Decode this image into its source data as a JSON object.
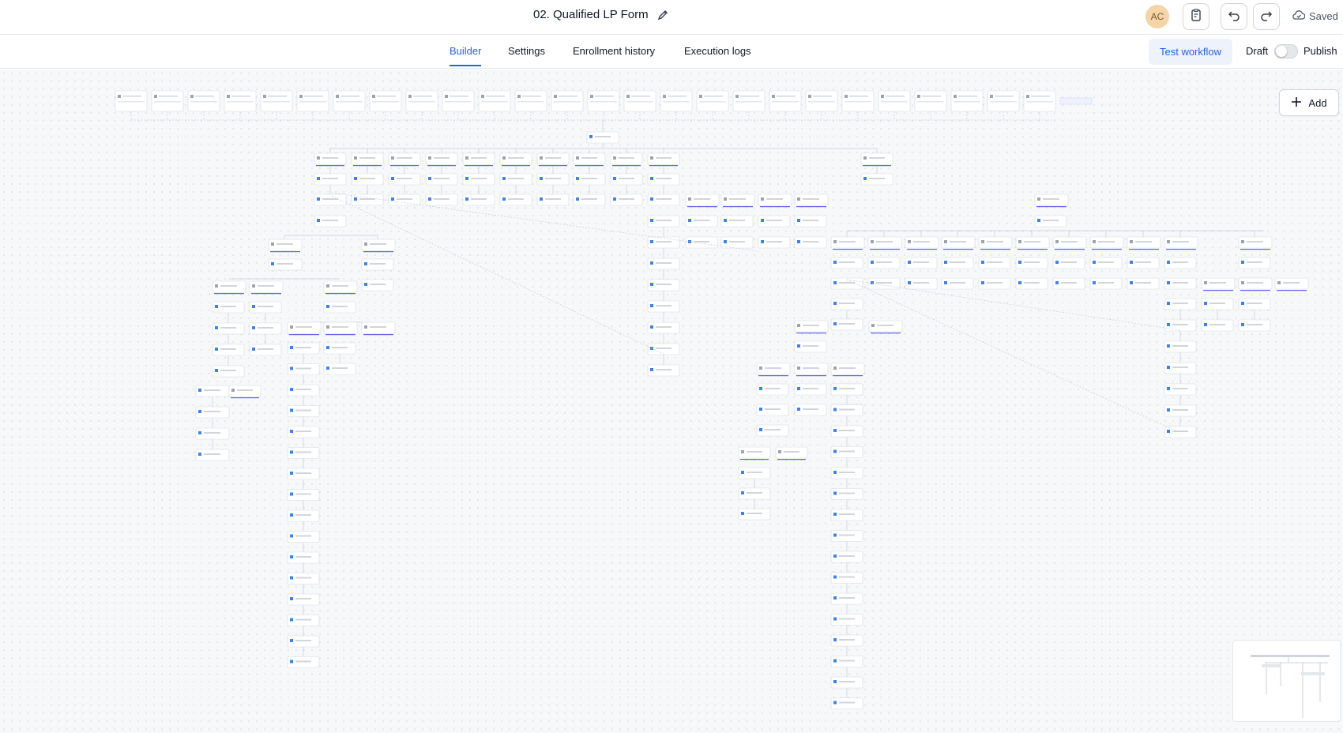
{
  "header": {
    "workflow_name": "02. Qualified LP Form",
    "avatar_initials": "AC",
    "saved_label": "Saved"
  },
  "tabs": [
    {
      "label": "Builder",
      "active": true
    },
    {
      "label": "Settings",
      "active": false
    },
    {
      "label": "Enrollment history",
      "active": false
    },
    {
      "label": "Execution logs",
      "active": false
    }
  ],
  "actions": {
    "test_workflow_label": "Test workflow",
    "draft_label": "Draft",
    "publish_label": "Publish",
    "publish_enabled": false
  },
  "canvas": {
    "add_label": "Add"
  },
  "colors": {
    "accent": "#2563eb",
    "edge": "#c7cbd3",
    "node_border": "#d6d9e0",
    "node_underline": "#6366f1"
  },
  "icons": {
    "edit": "pencil-icon",
    "notes": "clipboard-icon",
    "undo": "undo-icon",
    "redo": "redo-icon",
    "saved": "cloud-check-icon",
    "add": "plus-icon"
  }
}
